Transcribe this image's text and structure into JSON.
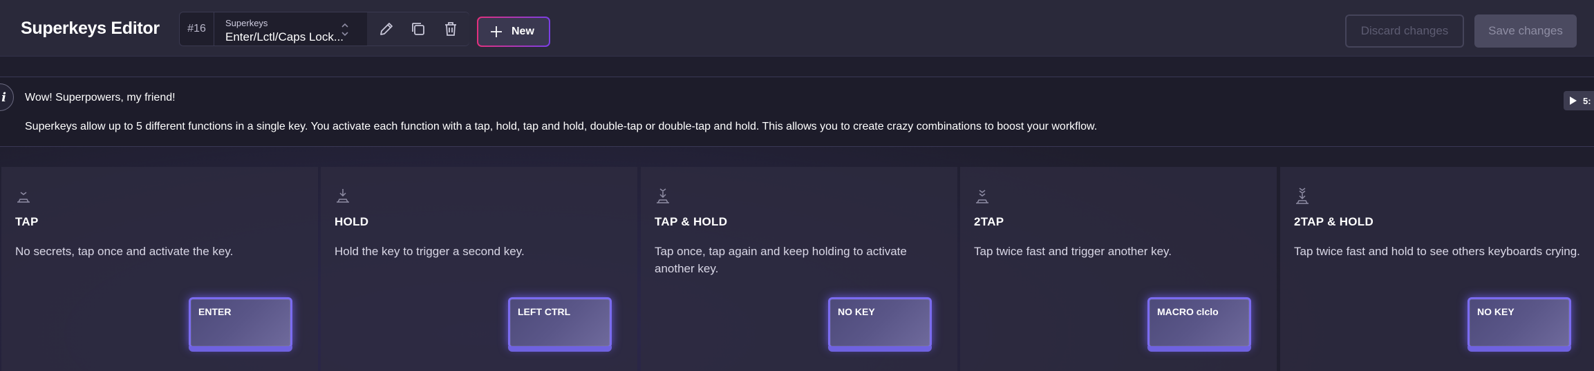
{
  "app": {
    "title": "Superkeys Editor"
  },
  "selector": {
    "id": "#16",
    "category": "Superkeys",
    "name": "Enter/Lctl/Caps Lock..."
  },
  "toolbar": {
    "new_label": "New",
    "discard_label": "Discard changes",
    "save_label": "Save changes"
  },
  "info": {
    "title": "Wow! Superpowers, my friend!",
    "text": "Superkeys allow up to 5 different functions in a single key. You activate each function with a tap, hold, tap and hold, double-tap or double-tap and hold. This allows you to create crazy combinations to boost your workflow.",
    "video_label": "5:"
  },
  "cards": [
    {
      "title": "TAP",
      "desc": "No secrets, tap once and activate the key.",
      "key": "ENTER",
      "icon": "tap-icon"
    },
    {
      "title": "HOLD",
      "desc": "Hold the key to trigger a second key.",
      "key": "LEFT CTRL",
      "icon": "hold-icon"
    },
    {
      "title": "TAP & HOLD",
      "desc": "Tap once, tap again and keep holding to activate another key.",
      "key": "NO KEY",
      "icon": "tap-hold-icon"
    },
    {
      "title": "2TAP",
      "desc": "Tap twice fast and trigger another key.",
      "key": "MACRO clclo",
      "icon": "double-tap-icon"
    },
    {
      "title": "2TAP & HOLD",
      "desc": "Tap twice fast and hold to see others keyboards crying.",
      "key": "NO KEY",
      "icon": "double-tap-hold-icon"
    }
  ],
  "colors": {
    "accent": "#7b6cf0",
    "new_gradient_start": "#e3307d",
    "new_gradient_end": "#7a3ee6"
  }
}
